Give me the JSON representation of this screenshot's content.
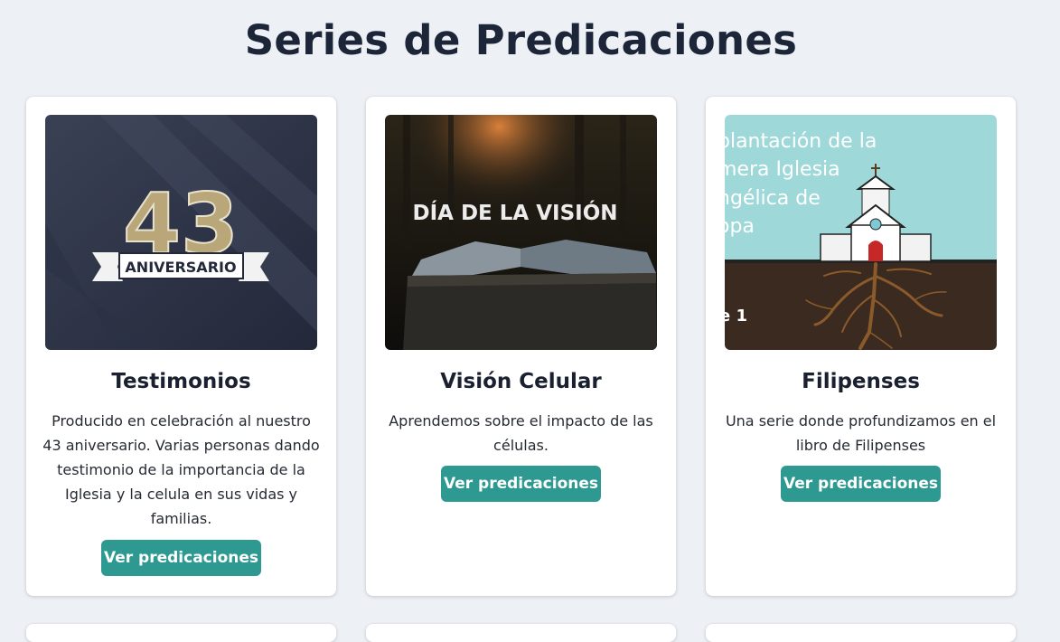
{
  "page": {
    "title": "Series de Predicaciones"
  },
  "series": [
    {
      "title": "Testimonios",
      "description": "Producido en celebración al nuestro 43 aniversario. Varias personas dando testimonio de la importancia de la Iglesia y la celula en sus vidas y familias.",
      "button_label": "Ver predicaciones",
      "image": {
        "number": "43",
        "banner_text": "ANIVERSARIO"
      }
    },
    {
      "title": "Visión Celular",
      "description": "Aprendemos sobre el impacto de las células.",
      "button_label": "Ver predicaciones",
      "image": {
        "headline": "DÍA DE LA VISIÓN"
      }
    },
    {
      "title": "Filipenses",
      "description": "Una serie donde profundizamos en el libro de Filipenses",
      "button_label": "Ver predicaciones",
      "image": {
        "line1": "plantación de la",
        "line2": "mera Iglesia",
        "line3": "ngélica de",
        "line4": "opa",
        "part_label": "e 1"
      }
    }
  ],
  "colors": {
    "page_background": "#edf1f6",
    "button": "#2e9990",
    "title": "#1d2538"
  }
}
